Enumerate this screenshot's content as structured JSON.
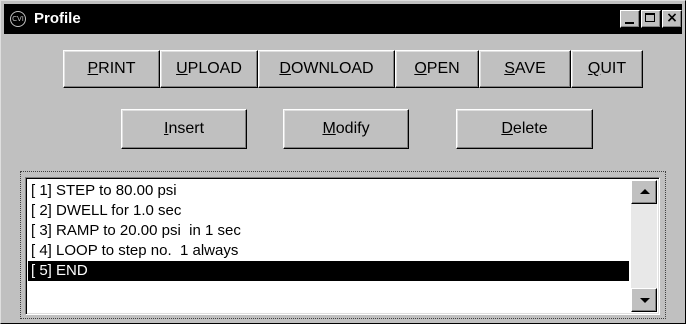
{
  "window": {
    "title": "Profile",
    "icon": "cvi-logo-icon",
    "controls": {
      "minimize": "minimize-icon",
      "maximize": "maximize-icon",
      "close": "×"
    }
  },
  "toolbar": {
    "print": {
      "mn": "P",
      "rest": "RINT"
    },
    "upload": {
      "mn": "U",
      "rest": "PLOAD"
    },
    "download": {
      "mn": "D",
      "rest": "OWNLOAD"
    },
    "open": {
      "mn": "O",
      "rest": "PEN"
    },
    "save": {
      "mn": "S",
      "rest": "AVE"
    },
    "quit": {
      "mn": "Q",
      "rest": "UIT"
    }
  },
  "actions": {
    "insert": {
      "mn": "I",
      "rest": "nsert"
    },
    "modify": {
      "mn": "M",
      "rest": "odify"
    },
    "delete": {
      "mn": "D",
      "rest": "elete"
    }
  },
  "steps": [
    "[ 1] STEP to 80.00 psi",
    "[ 2] DWELL for 1.0 sec",
    "[ 3] RAMP to 20.00 psi  in 1 sec",
    "[ 4] LOOP to step no.  1 always",
    "[ 5] END"
  ],
  "selected_step_index": 4
}
